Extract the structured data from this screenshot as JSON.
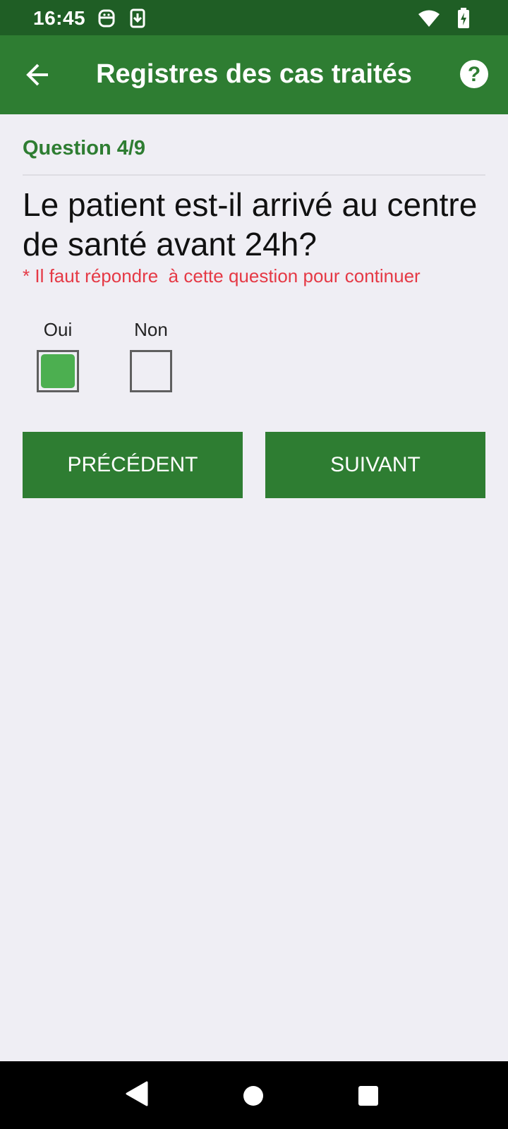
{
  "status_bar": {
    "time": "16:45",
    "icons": [
      "notification-face-icon",
      "download-icon",
      "wifi-icon",
      "battery-charging-icon"
    ]
  },
  "app_bar": {
    "title": "Registres des cas traités",
    "back_icon": "arrow-back-icon",
    "help_icon": "help-circle-icon"
  },
  "question": {
    "number": "Question 4/9",
    "text": "Le patient est-il arrivé au centre de santé avant 24h?",
    "required_note": "* Il faut répondre  à cette question pour continuer"
  },
  "options": [
    {
      "label": "Oui",
      "checked": true
    },
    {
      "label": "Non",
      "checked": false
    }
  ],
  "buttons": {
    "previous": "PRÉCÉDENT",
    "next": "SUIVANT"
  },
  "colors": {
    "status_bar": "#1f5e25",
    "primary": "#2e7d32",
    "checked_fill": "#4caf50",
    "error": "#e53945",
    "background": "#efeef4"
  },
  "system_nav": [
    "back-triangle-icon",
    "home-circle-icon",
    "recents-square-icon"
  ]
}
